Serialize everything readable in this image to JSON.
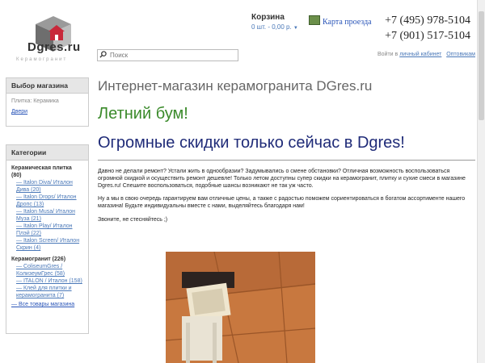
{
  "header": {
    "logo_text": "Dgres.ru",
    "logo_sub": "Керамогранит",
    "cart_title": "Корзина",
    "cart_value": "0 шт. - 0,00 р.",
    "map_label": "Карта проезда",
    "phones": [
      "+7 (495) 978-5104",
      "+7 (901) 517-5104"
    ],
    "search_placeholder": "Поиск",
    "login_prefix": "Войти в",
    "login_link": "личный кабинет",
    "wholesale_link": "Оптовикам"
  },
  "sidebar": {
    "store_panel_title": "Выбор магазина",
    "store_current": "Плитка: Керамика",
    "store_link": "Двери",
    "categories_title": "Категории",
    "groups": [
      {
        "name": "Керамическая плитка (80)",
        "items": [
          "— Italon Diva/ Италон Дива (20)",
          "— Italon Drops/ Италон Дропс (13)",
          "— Italon Musa/ Италон Муза (21)",
          "— Italon Play/ Италон Плэй (22)",
          "— Italon Screen/ Италон Скрин (4)"
        ]
      },
      {
        "name": "Керамогранит (226)",
        "items": [
          "— ColiseumGres / КолизеумГрес (58)",
          "— ITALON / Италон (158)",
          "— Клей для плитки и керамогранита (7)"
        ]
      }
    ],
    "all_link": "— Все товары магазина"
  },
  "main": {
    "heading": "Интернет-магазин керамогранита DGres.ru",
    "promo_green": "Летний бум!",
    "promo_blue": "Огромные скидки только сейчас в Dgres!",
    "paragraph1": "Давно не делали ремонт? Устали жить в однообразии? Задумывались о смене обстановки? Отличная возможность воспользоваться огромной скидкой и осуществить ремонт дешевле! Только летом доступны супер скидки на керамогранит, плитку и сухие смеси в магазине Dgres.ru! Спешите воспользоваться, подобные шансы возникают не так уж часто.",
    "paragraph2": "Ну а мы в свою очередь гарантируем вам отличные цены, а также с радостью поможем сориентироваться в богатом ассортименте нашего магазина! Будьте индивидуальны вместе с нами, выделяйтесь благодаря нам!",
    "paragraph3": "Звоните, не стесняйтесь ;)"
  },
  "colors": {
    "link": "#2a55b8",
    "green": "#3a8a2a",
    "blue": "#1f2b78"
  }
}
